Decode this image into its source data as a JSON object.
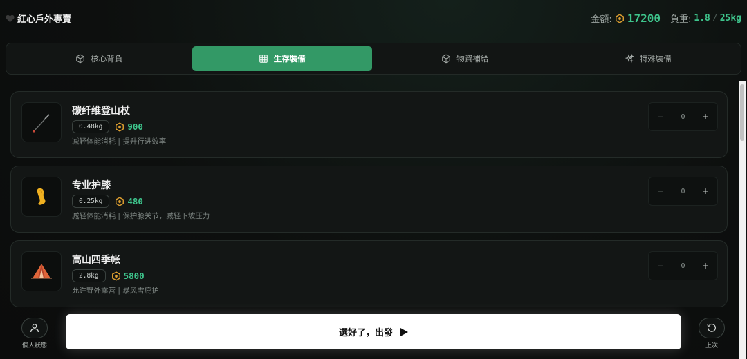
{
  "header": {
    "brand": "紅心戶外專賣",
    "gold_label": "金額:",
    "gold_value": "17200",
    "weight_label": "負重:",
    "weight_current": "1.8",
    "weight_sep": "/",
    "weight_max": "25kg"
  },
  "tabs": [
    {
      "label": "核心背負",
      "icon": "box-icon",
      "active": false
    },
    {
      "label": "生存裝備",
      "icon": "grid-icon",
      "active": true
    },
    {
      "label": "物資補給",
      "icon": "box-icon",
      "active": false
    },
    {
      "label": "特殊裝備",
      "icon": "sparkle-icon",
      "active": false
    }
  ],
  "items": [
    {
      "name": "碳纤维登山杖",
      "weight": "0.48kg",
      "price": "900",
      "desc": "减轻体能消耗 | 提升行进效率",
      "qty": "0",
      "icon": "trekking-pole-icon"
    },
    {
      "name": "专业护膝",
      "weight": "0.25kg",
      "price": "480",
      "desc": "减轻体能消耗 | 保护膝关节，减轻下坡压力",
      "qty": "0",
      "icon": "knee-pad-icon"
    },
    {
      "name": "高山四季帐",
      "weight": "2.8kg",
      "price": "5800",
      "desc": "允许野外露营 | 暴风雪庇护",
      "qty": "0",
      "icon": "tent-icon"
    }
  ],
  "stepper": {
    "minus": "−",
    "plus": "+"
  },
  "bottom": {
    "profile_label": "個人狀態",
    "go_label": "選好了，出發",
    "undo_label": "上次"
  },
  "colors": {
    "accent": "#339966",
    "gold": "#3ec48c",
    "coin": "#e0a030"
  }
}
